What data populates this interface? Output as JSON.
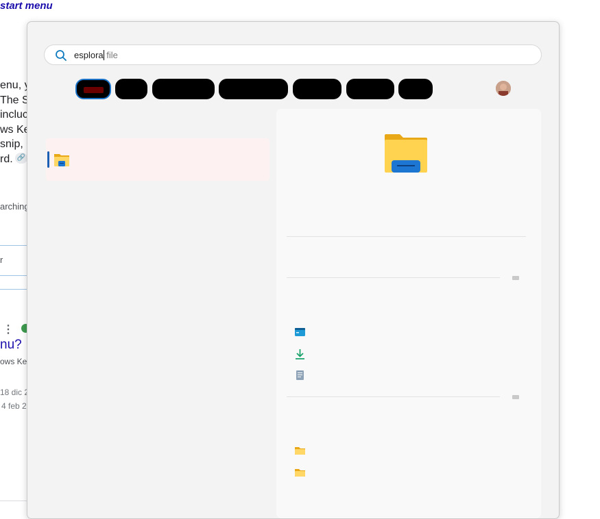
{
  "background_page": {
    "title": "start menu",
    "paragraph_lines": [
      "enu, y",
      " The S",
      " incluc",
      "ws Key",
      " snip,",
      "rd."
    ],
    "snippet_text": "arching",
    "row_text": "r",
    "question_text": "nu?",
    "question_sub": "ows Key",
    "date_1": "18 dic 2",
    "date_2": "4 feb 2"
  },
  "search": {
    "typed": "esplora",
    "suggestion": " file"
  },
  "colors": {
    "accent": "#1a73c9",
    "selection_bar": "#1a5fb4",
    "highlight_bg": "#fdf1f1",
    "panel_bg": "#f3f3f3"
  },
  "icons": {
    "search": "search-icon",
    "best_match": "file-explorer-icon",
    "preview": "file-explorer-icon",
    "actions": [
      "terminal-icon",
      "download-icon",
      "document-icon"
    ],
    "recent": [
      "folder-icon",
      "folder-icon"
    ]
  }
}
